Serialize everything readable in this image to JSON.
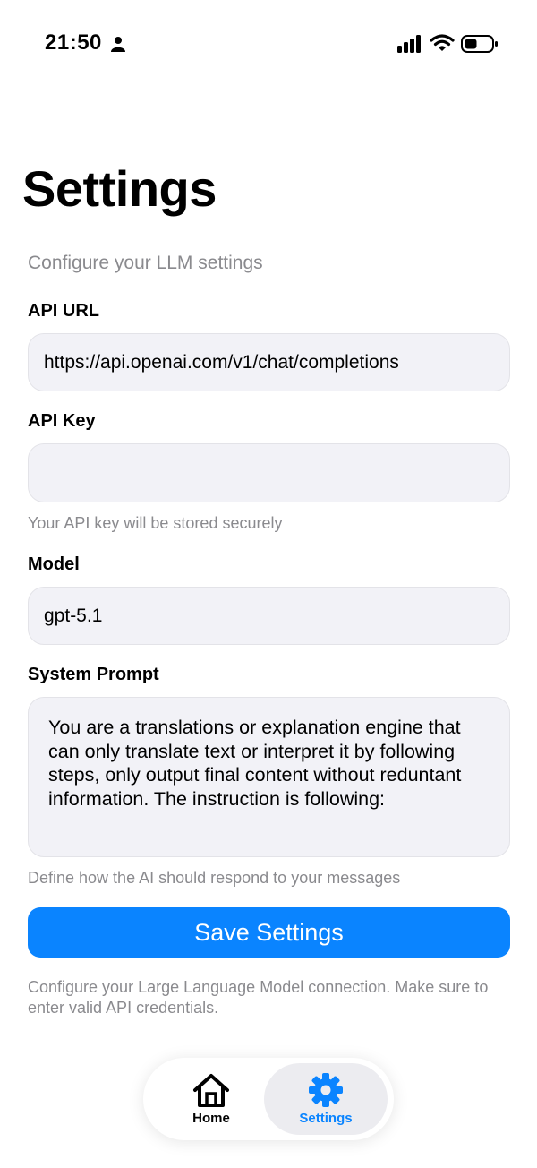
{
  "status_bar": {
    "time": "21:50",
    "icons": [
      "person-icon",
      "cellular-signal-icon",
      "wifi-icon",
      "battery-icon"
    ]
  },
  "header": {
    "title": "Settings",
    "subtitle": "Configure your LLM settings"
  },
  "form": {
    "api_url": {
      "label": "API URL",
      "value": "https://api.openai.com/v1/chat/completions"
    },
    "api_key": {
      "label": "API Key",
      "value": "",
      "helper": "Your API key will be stored securely"
    },
    "model": {
      "label": "Model",
      "value": "gpt-5.1"
    },
    "system_prompt": {
      "label": "System Prompt",
      "value": "You are a translations or explanation engine that can only translate text or interpret it by following steps, only output final content without reduntant information. The instruction is following:",
      "helper": "Define how the AI should respond to your messages"
    },
    "save_label": "Save Settings",
    "footer_note": "Configure your Large Language Model connection. Make sure to enter valid API credentials."
  },
  "tab_bar": {
    "tabs": [
      {
        "label": "Home",
        "icon": "house-icon",
        "active": false
      },
      {
        "label": "Settings",
        "icon": "gear-icon",
        "active": true
      }
    ]
  },
  "colors": {
    "accent": "#0a84ff",
    "field_background": "#f2f2f7",
    "secondary_text": "#8a8a8e"
  }
}
